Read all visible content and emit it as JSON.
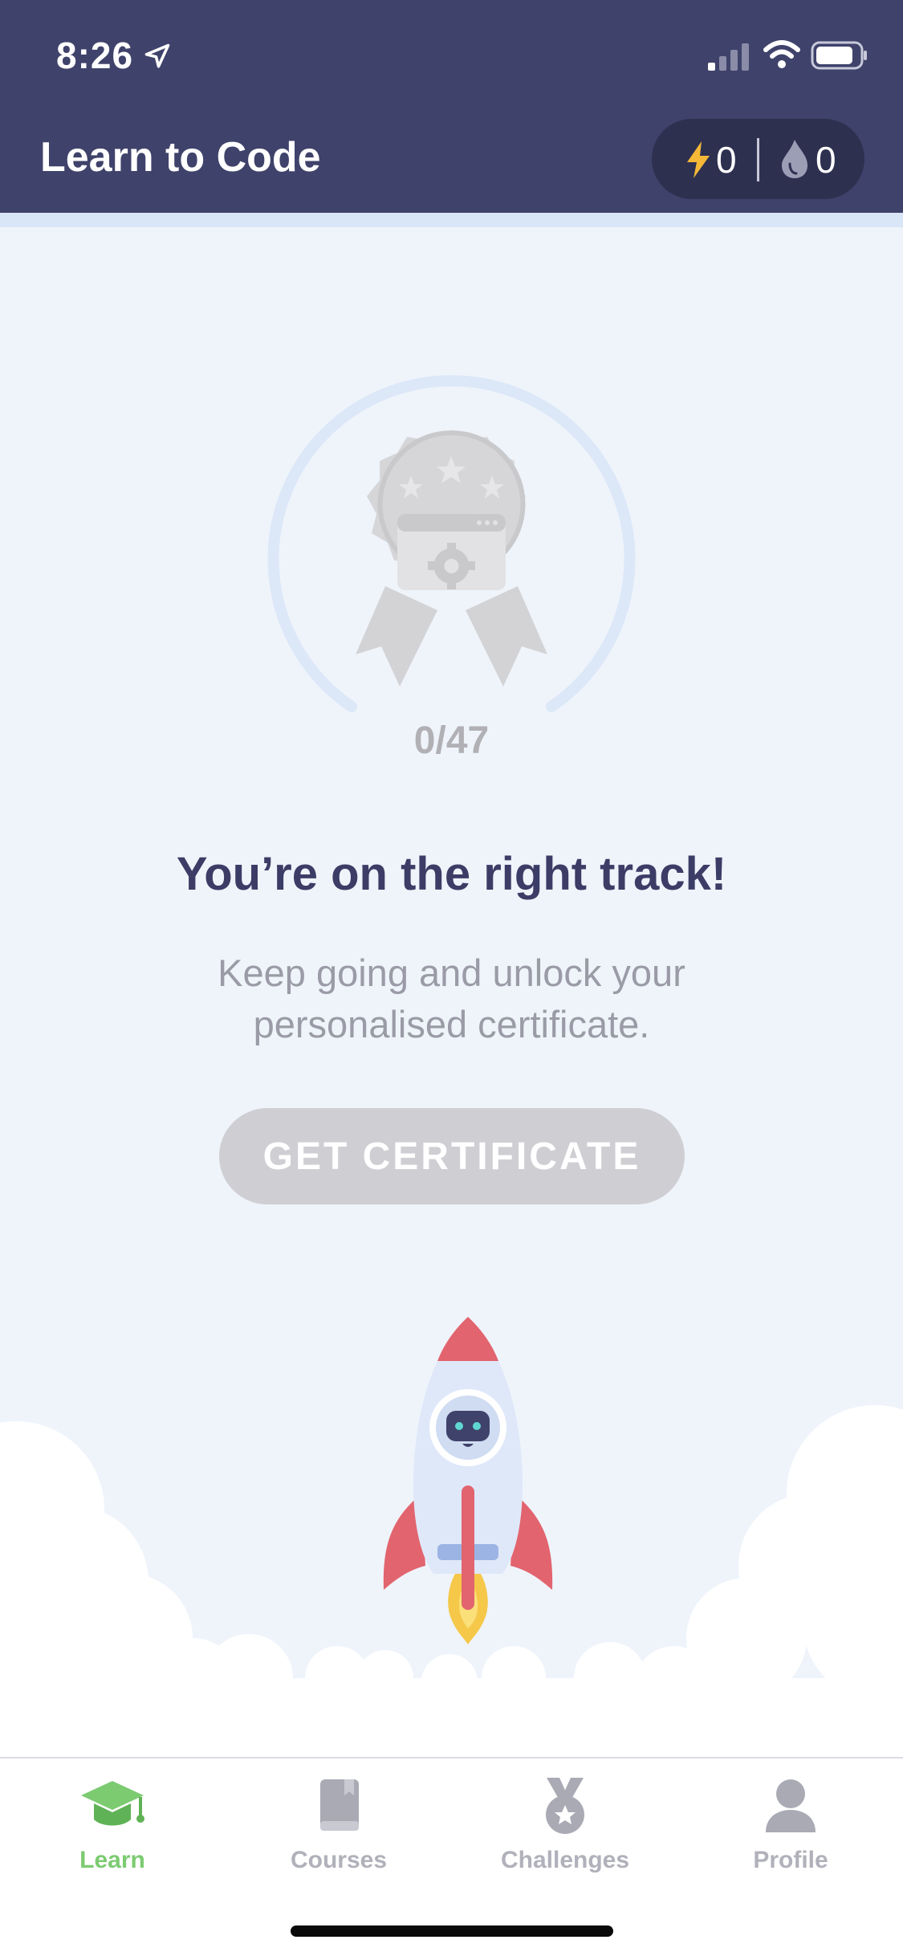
{
  "status_bar": {
    "time": "8:26"
  },
  "header": {
    "title": "Learn to Code",
    "bolt_count": "0",
    "streak_count": "0"
  },
  "progress": {
    "label": "0/47",
    "completed": 0,
    "total": 47
  },
  "headline": "You’re on the right track!",
  "subtext": "Keep going and unlock your personalised certificate.",
  "cert_button": "GET CERTIFICATE",
  "nav": {
    "learn": "Learn",
    "courses": "Courses",
    "challenges": "Challenges",
    "profile": "Profile"
  },
  "colors": {
    "header_bg": "#3f426a",
    "accent_green": "#7ccb71",
    "bolt": "#f5b937",
    "disabled_button": "#cfcfd3"
  }
}
